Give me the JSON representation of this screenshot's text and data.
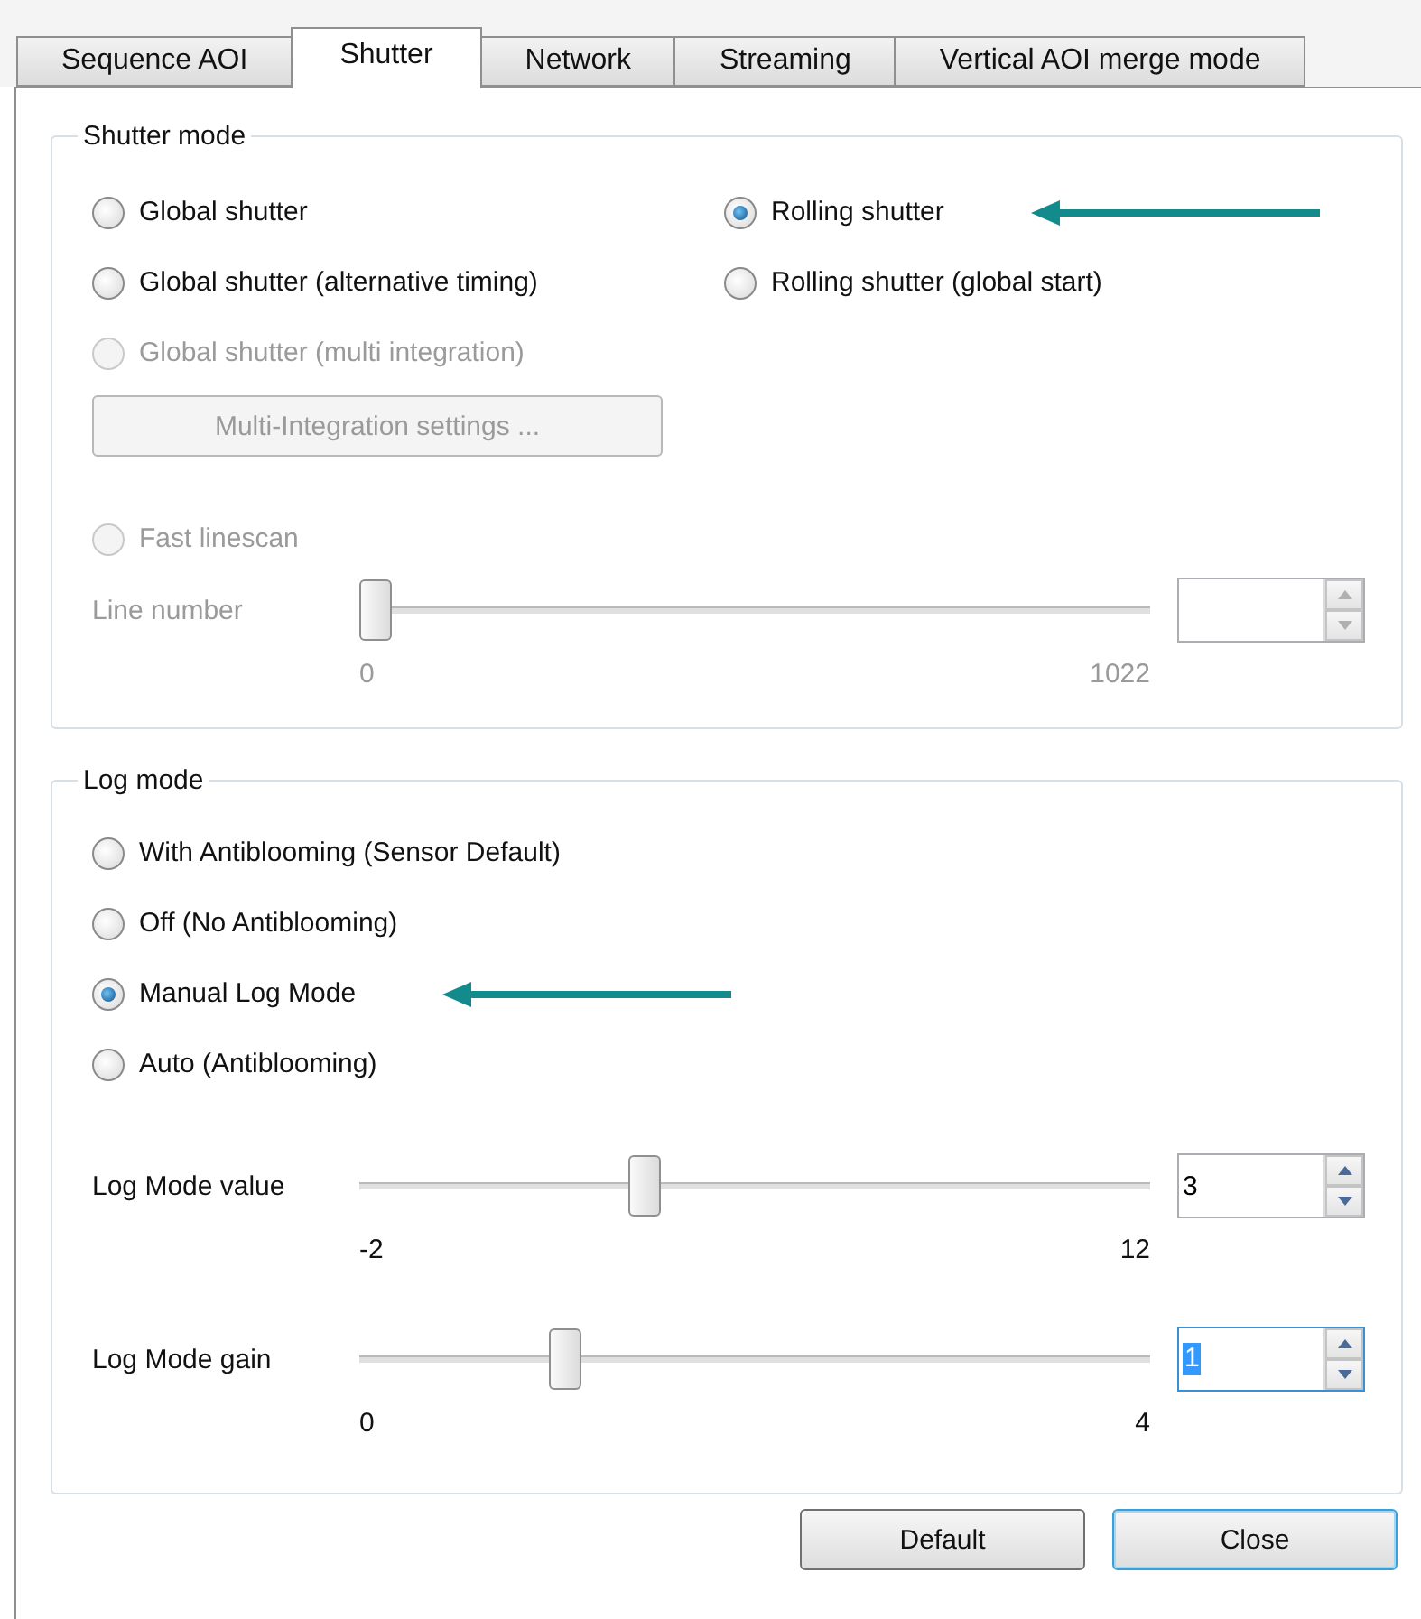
{
  "tabs": [
    {
      "label": "Sequence AOI",
      "selected": false
    },
    {
      "label": "Shutter",
      "selected": true
    },
    {
      "label": "Network",
      "selected": false
    },
    {
      "label": "Streaming",
      "selected": false
    },
    {
      "label": "Vertical AOI merge mode",
      "selected": false
    }
  ],
  "shutter_mode": {
    "title": "Shutter mode",
    "options": [
      {
        "label": "Global shutter",
        "selected": false,
        "disabled": false,
        "arrow": false
      },
      {
        "label": "Rolling shutter",
        "selected": true,
        "disabled": false,
        "arrow": true
      },
      {
        "label": "Global shutter (alternative timing)",
        "selected": false,
        "disabled": false,
        "arrow": false
      },
      {
        "label": "Rolling shutter (global start)",
        "selected": false,
        "disabled": false,
        "arrow": false
      },
      {
        "label": "Global shutter (multi integration)",
        "selected": false,
        "disabled": true,
        "arrow": false
      }
    ],
    "settings_button": {
      "label": "Multi-Integration settings ...",
      "disabled": true
    },
    "fast_linescan": {
      "label": "Fast linescan",
      "selected": false,
      "disabled": true
    },
    "line_number": {
      "label": "Line number",
      "level": 0,
      "min": "0",
      "max": "1022",
      "disabled": true,
      "focused": false
    }
  },
  "log_mode": {
    "title": "Log mode",
    "options": [
      {
        "label": "With Antiblooming (Sensor Default)",
        "selected": false,
        "disabled": false,
        "arrow": false
      },
      {
        "label": "Off (No Antiblooming)",
        "selected": false,
        "disabled": false,
        "arrow": false
      },
      {
        "label": "Manual Log Mode",
        "selected": true,
        "disabled": false,
        "arrow": true
      },
      {
        "label": "Auto (Antiblooming)",
        "selected": false,
        "disabled": false,
        "arrow": false
      }
    ],
    "sliders": [
      {
        "label": "Log Mode value",
        "level": 0.36,
        "min": "-2",
        "max": "12",
        "value": "3",
        "disabled": false,
        "focused": false
      },
      {
        "label": "Log Mode gain",
        "level": 0.26,
        "min": "0",
        "max": "4",
        "value": "1",
        "disabled": false,
        "focused": true
      }
    ]
  },
  "buttons": [
    {
      "label": "Default",
      "default": false
    },
    {
      "label": "Close",
      "default": true
    }
  ]
}
